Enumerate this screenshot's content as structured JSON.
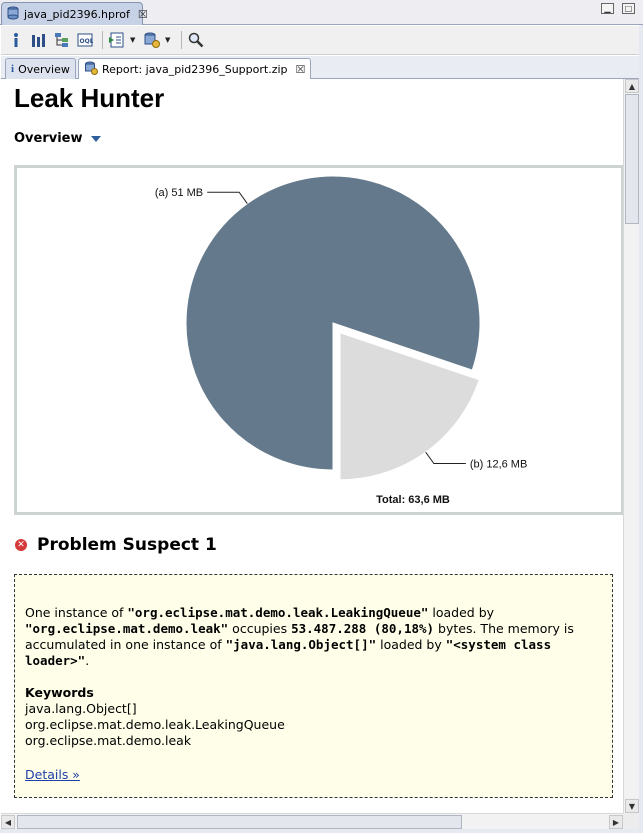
{
  "editor": {
    "tab_label": "java_pid2396.hprof",
    "tab_close": "☒"
  },
  "toolbar": {
    "buttons": [
      "info-icon",
      "histogram-icon",
      "dominator-tree-icon",
      "oql-icon",
      "run-report-icon",
      "heap-dump-icon",
      "search-icon"
    ]
  },
  "report_tabs": [
    {
      "label": "Overview"
    },
    {
      "label": "Report: java_pid2396_Support.zip",
      "close": "☒"
    }
  ],
  "page": {
    "title": "Leak Hunter",
    "overview_label": "Overview"
  },
  "chart_data": {
    "type": "pie",
    "categories": [
      "(a) 51 MB",
      "(b) 12,6 MB"
    ],
    "values": [
      51,
      12.6
    ],
    "colors": [
      "#647a8c",
      "#dcdcdc"
    ],
    "exploded": [
      false,
      true
    ],
    "total_label": "Total: 63,6 MB"
  },
  "suspect": {
    "title": "Problem Suspect 1",
    "t1": "One instance of ",
    "class_name": "\"org.eclipse.mat.demo.leak.LeakingQueue\"",
    "t2": " loaded by ",
    "loader": "\"org.eclipse.mat.demo.leak\"",
    "t3": " occupies ",
    "size": "53.487.288 (80,18%)",
    "t4": " bytes. The memory is accumulated in one instance of ",
    "acc_class": "\"java.lang.Object[]\"",
    "t5": " loaded by ",
    "acc_loader": "\"<system class loader>\"",
    "t6": ".",
    "keywords_label": "Keywords",
    "keywords": [
      "java.lang.Object[]",
      "org.eclipse.mat.demo.leak.LeakingQueue",
      "org.eclipse.mat.demo.leak"
    ],
    "details_label": "Details »"
  }
}
